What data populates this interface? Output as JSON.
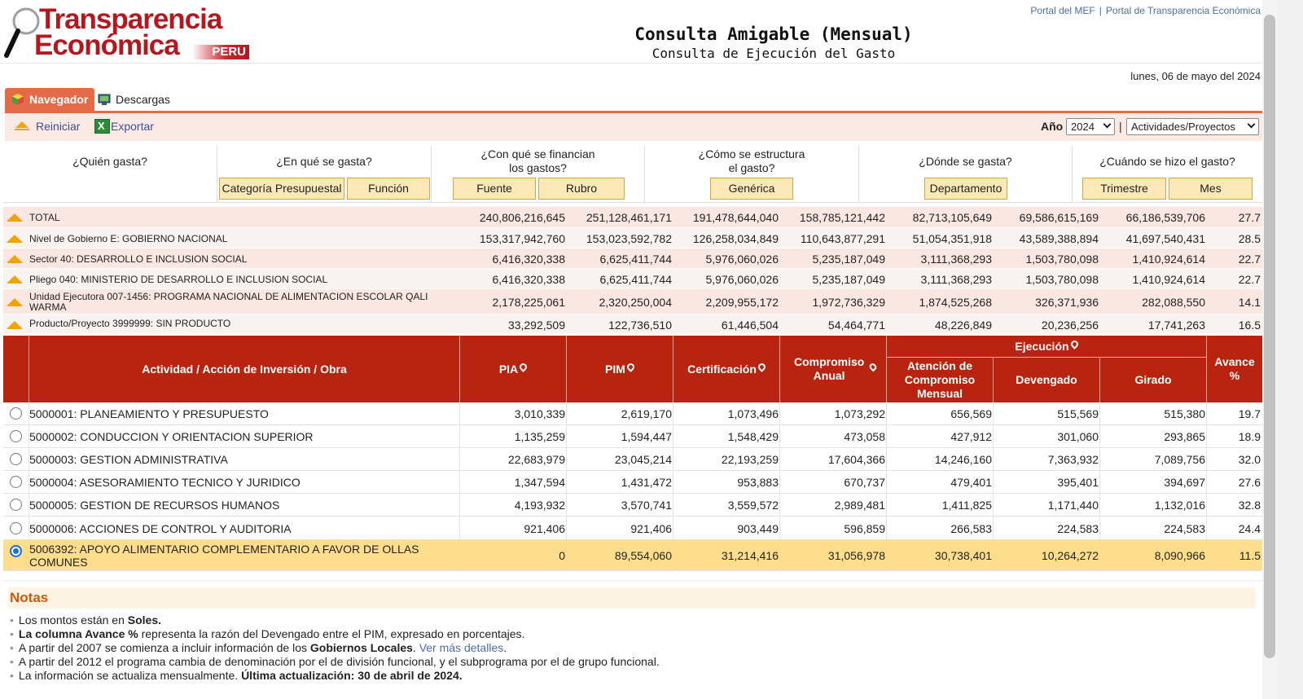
{
  "header": {
    "logo_line1": "Transparencia",
    "logo_line2": "Económica",
    "logo_badge": "PERU",
    "title": "Consulta Amigable (Mensual)",
    "subtitle": "Consulta de Ejecución del Gasto",
    "links": [
      "Portal del MEF",
      "Portal de Transparencia Económica"
    ],
    "date": "lunes, 06 de mayo del 2024"
  },
  "tabs": [
    {
      "label": "Navegador",
      "active": true
    },
    {
      "label": "Descargas",
      "active": false
    }
  ],
  "toolbar": {
    "reiniciar": "Reiniciar",
    "exportar": "Exportar",
    "anio_label": "Año",
    "anio_value": "2024",
    "pipe": "|",
    "tipo_value": "Actividades/Proyectos"
  },
  "questions": [
    {
      "title": "¿Quién gasta?",
      "buttons": []
    },
    {
      "title": "¿En qué se gasta?",
      "buttons": [
        "Categoría Presupuestal",
        "Función"
      ]
    },
    {
      "title": "¿Con qué se financian los gastos?",
      "buttons": [
        "Fuente",
        "Rubro"
      ]
    },
    {
      "title": "¿Cómo se estructura el gasto?",
      "buttons": [
        "Genérica"
      ]
    },
    {
      "title": "¿Dónde se gasta?",
      "buttons": [
        "Departamento"
      ]
    },
    {
      "title": "¿Cuándo se hizo el gasto?",
      "buttons": [
        "Trimestre",
        "Mes"
      ]
    }
  ],
  "summary_rows": [
    {
      "label": "TOTAL",
      "values": [
        "240,806,216,645",
        "251,128,461,171",
        "191,478,644,040",
        "158,785,121,442",
        "82,713,105,649",
        "69,586,615,169",
        "66,186,539,706",
        "27.7"
      ]
    },
    {
      "label": "Nivel de Gobierno E: GOBIERNO NACIONAL",
      "values": [
        "153,317,942,760",
        "153,023,592,782",
        "126,258,034,849",
        "110,643,877,291",
        "51,054,351,918",
        "43,589,388,894",
        "41,697,540,431",
        "28.5"
      ]
    },
    {
      "label": "Sector 40: DESARROLLO E INCLUSION SOCIAL",
      "values": [
        "6,416,320,338",
        "6,625,411,744",
        "5,976,060,026",
        "5,235,187,049",
        "3,111,368,293",
        "1,503,780,098",
        "1,410,924,614",
        "22.7"
      ]
    },
    {
      "label": "Pliego 040: MINISTERIO DE DESARROLLO E INCLUSION SOCIAL",
      "values": [
        "6,416,320,338",
        "6,625,411,744",
        "5,976,060,026",
        "5,235,187,049",
        "3,111,368,293",
        "1,503,780,098",
        "1,410,924,614",
        "22.7"
      ]
    },
    {
      "label": "Unidad Ejecutora 007-1456: PROGRAMA NACIONAL DE ALIMENTACION ESCOLAR QALI WARMA",
      "values": [
        "2,178,225,061",
        "2,320,250,004",
        "2,209,955,172",
        "1,972,736,329",
        "1,874,525,268",
        "326,371,936",
        "282,088,550",
        "14.1"
      ]
    },
    {
      "label": "Producto/Proyecto 3999999: SIN PRODUCTO",
      "values": [
        "33,292,509",
        "122,736,510",
        "61,446,504",
        "54,464,771",
        "48,226,849",
        "20,236,256",
        "17,741,263",
        "16.5"
      ]
    }
  ],
  "table_header": {
    "actividad": "Actividad / Acción de Inversión / Obra",
    "pia": "PIA",
    "pim": "PIM",
    "certificacion": "Certificación",
    "compromiso": "Compromiso Anual",
    "ejecucion": "Ejecución",
    "atencion": "Atención de Compromiso Mensual",
    "devengado": "Devengado",
    "girado": "Girado",
    "avance": "Avance %"
  },
  "table_rows": [
    {
      "name": "5000001: PLANEAMIENTO Y PRESUPUESTO",
      "values": [
        "3,010,339",
        "2,619,170",
        "1,073,496",
        "1,073,292",
        "656,569",
        "515,569",
        "515,380",
        "19.7"
      ],
      "selected": false
    },
    {
      "name": "5000002: CONDUCCION Y ORIENTACION SUPERIOR",
      "values": [
        "1,135,259",
        "1,594,447",
        "1,548,429",
        "473,058",
        "427,912",
        "301,060",
        "293,865",
        "18.9"
      ],
      "selected": false
    },
    {
      "name": "5000003: GESTION ADMINISTRATIVA",
      "values": [
        "22,683,979",
        "23,045,214",
        "22,193,259",
        "17,604,366",
        "14,246,160",
        "7,363,932",
        "7,089,756",
        "32.0"
      ],
      "selected": false
    },
    {
      "name": "5000004: ASESORAMIENTO TECNICO Y JURIDICO",
      "values": [
        "1,347,594",
        "1,431,472",
        "953,883",
        "670,737",
        "479,401",
        "395,401",
        "394,697",
        "27.6"
      ],
      "selected": false
    },
    {
      "name": "5000005: GESTION DE RECURSOS HUMANOS",
      "values": [
        "4,193,932",
        "3,570,741",
        "3,559,572",
        "2,989,481",
        "1,411,825",
        "1,171,440",
        "1,132,016",
        "32.8"
      ],
      "selected": false
    },
    {
      "name": "5000006: ACCIONES DE CONTROL Y AUDITORIA",
      "values": [
        "921,406",
        "921,406",
        "903,449",
        "596,859",
        "266,583",
        "224,583",
        "224,583",
        "24.4"
      ],
      "selected": false
    },
    {
      "name": "5006392: APOYO ALIMENTARIO COMPLEMENTARIO A FAVOR DE OLLAS COMUNES",
      "values": [
        "0",
        "89,554,060",
        "31,214,416",
        "31,056,978",
        "30,738,401",
        "10,264,272",
        "8,090,966",
        "11.5"
      ],
      "selected": true
    }
  ],
  "notes": {
    "title": "Notas",
    "n1_a": "Los montos están en ",
    "n1_b": "Soles.",
    "n2_a": "La columna Avance %",
    "n2_b": " representa la razón del Devengado entre el PIM, expresado en porcentajes.",
    "n3_a": "A partir del 2007 se comienza a incluir información de los ",
    "n3_b": "Gobiernos Locales",
    "n3_c": ". ",
    "n3_link": "Ver más detalles",
    "n3_d": ".",
    "n4": "A partir del 2012 el programa cambia de denominación por el de división funcional, y el subprograma por el de grupo funcional.",
    "n5_a": "La información se actualiza mensualmente. ",
    "n5_b": "Última actualización: 30 de abril de 2024."
  },
  "colors": {
    "brand_red": "#b5171f",
    "header_red": "#b8240f",
    "tab_orange": "#e36b47",
    "button_fill": "#fde9b7",
    "selected_row": "#fede8c"
  }
}
